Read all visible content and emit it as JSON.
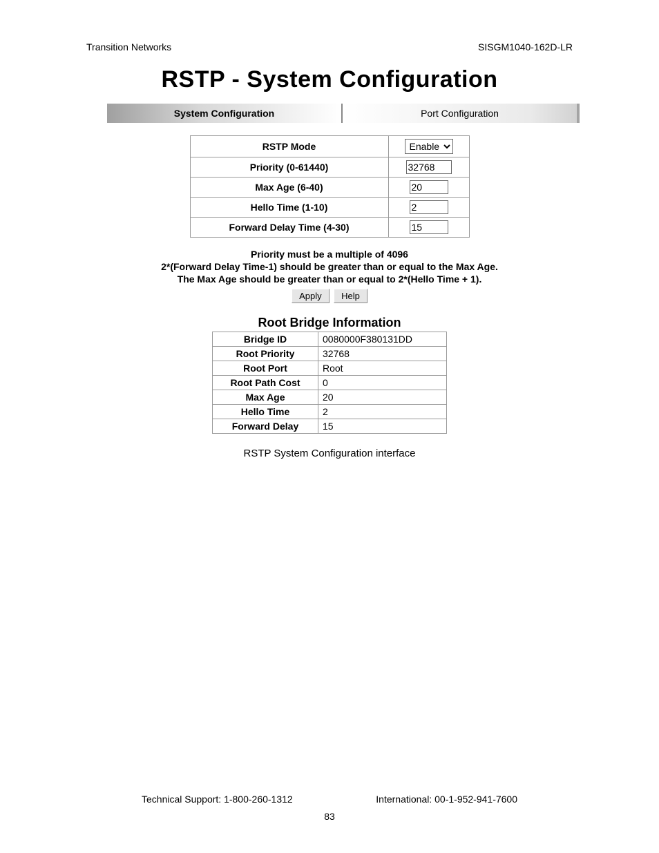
{
  "header": {
    "left": "Transition Networks",
    "right": "SISGM1040-162D-LR"
  },
  "title": "RSTP - System Configuration",
  "tabs": {
    "active": "System Configuration",
    "inactive": "Port Configuration"
  },
  "config_rows": [
    {
      "label": "RSTP Mode",
      "type": "select",
      "value": "Enable"
    },
    {
      "label": "Priority (0-61440)",
      "type": "input",
      "value": "32768",
      "wide": true
    },
    {
      "label": "Max Age (6-40)",
      "type": "input",
      "value": "20"
    },
    {
      "label": "Hello Time (1-10)",
      "type": "input",
      "value": "2"
    },
    {
      "label": "Forward Delay Time (4-30)",
      "type": "input",
      "value": "15"
    }
  ],
  "notes": {
    "line1": "Priority must be a multiple of 4096",
    "line2": "2*(Forward Delay Time-1) should be greater than or equal to the Max Age.",
    "line3": "The Max Age should be greater than or equal to 2*(Hello Time + 1)."
  },
  "buttons": {
    "apply": "Apply",
    "help": "Help"
  },
  "root_bridge": {
    "title": "Root Bridge Information",
    "rows": [
      {
        "label": "Bridge ID",
        "value": "0080000F380131DD"
      },
      {
        "label": "Root Priority",
        "value": "32768"
      },
      {
        "label": "Root Port",
        "value": "Root"
      },
      {
        "label": "Root Path Cost",
        "value": "0"
      },
      {
        "label": "Max Age",
        "value": "20"
      },
      {
        "label": "Hello Time",
        "value": "2"
      },
      {
        "label": "Forward Delay",
        "value": "15"
      }
    ]
  },
  "caption": "RSTP System Configuration interface",
  "footer": {
    "left": "Technical Support: 1-800-260-1312",
    "right": "International: 00-1-952-941-7600",
    "page": "83"
  }
}
